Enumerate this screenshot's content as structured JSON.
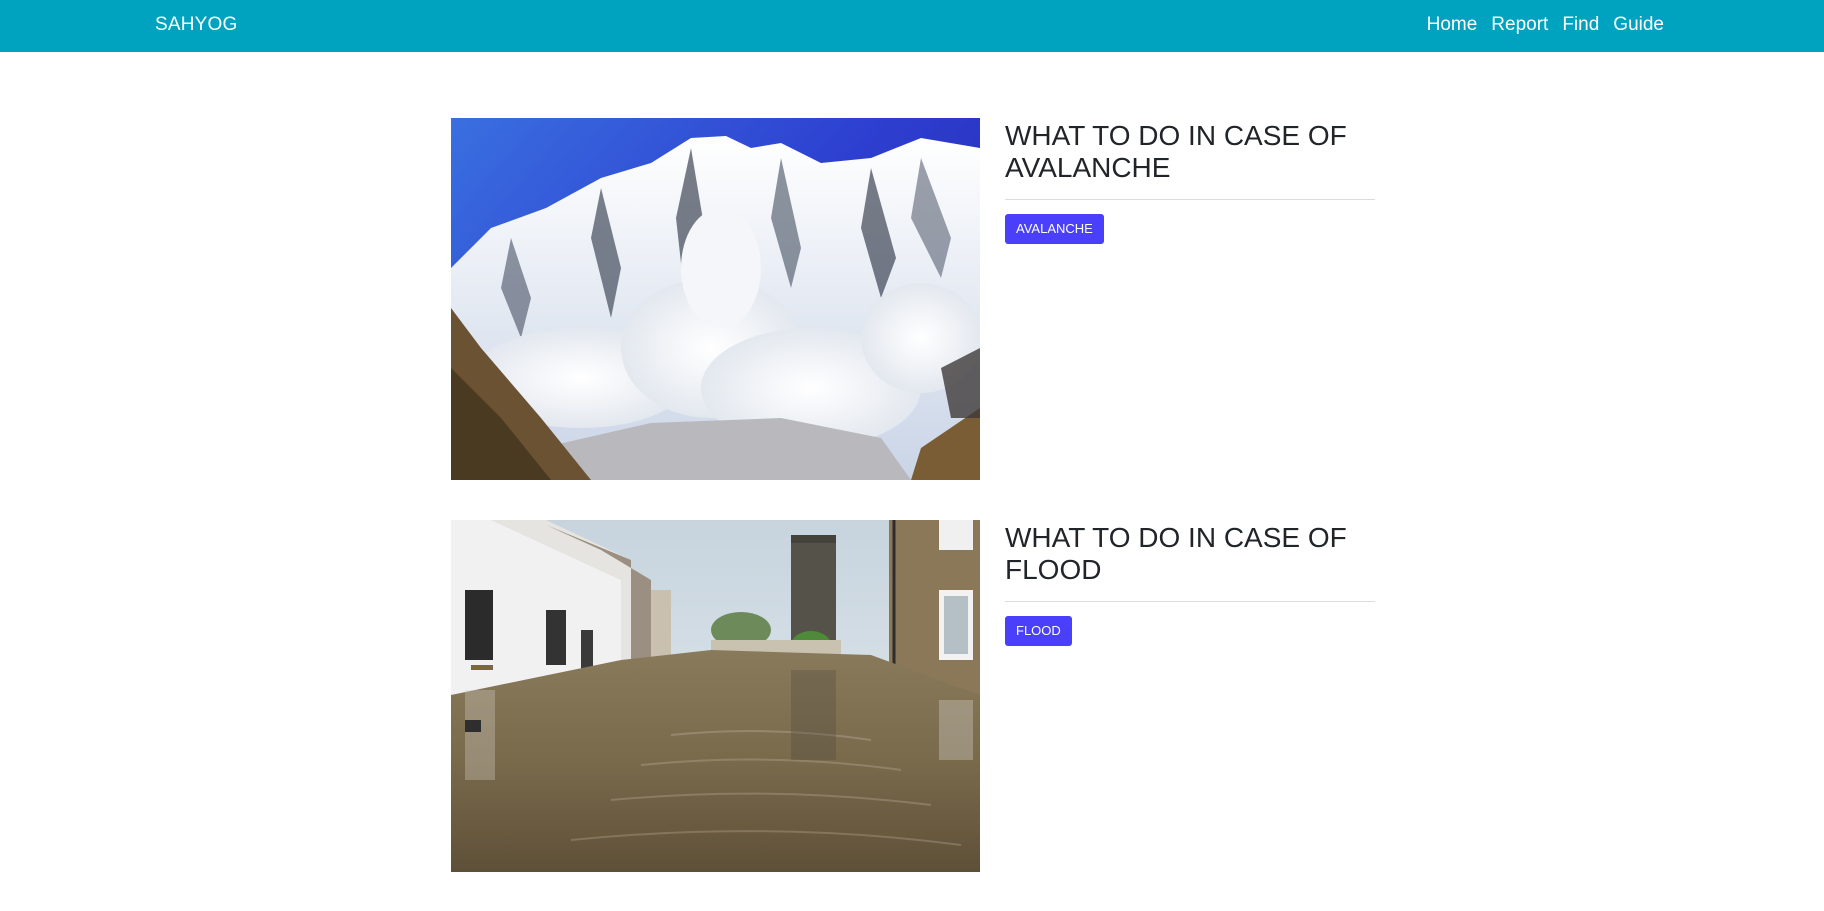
{
  "navbar": {
    "brand": "SAHYOG",
    "links": [
      {
        "label": "Home"
      },
      {
        "label": "Report"
      },
      {
        "label": "Find"
      },
      {
        "label": "Guide"
      }
    ],
    "background": "#00a3bf"
  },
  "cards": [
    {
      "title": "WHAT TO DO IN CASE OF AVALANCHE",
      "tag": "AVALANCHE",
      "image": "avalanche-photo"
    },
    {
      "title": "WHAT TO DO IN CASE OF FLOOD",
      "tag": "FLOOD",
      "image": "flood-photo"
    }
  ],
  "colors": {
    "tag_button": "#4a3ffa",
    "title_text": "#212529"
  }
}
